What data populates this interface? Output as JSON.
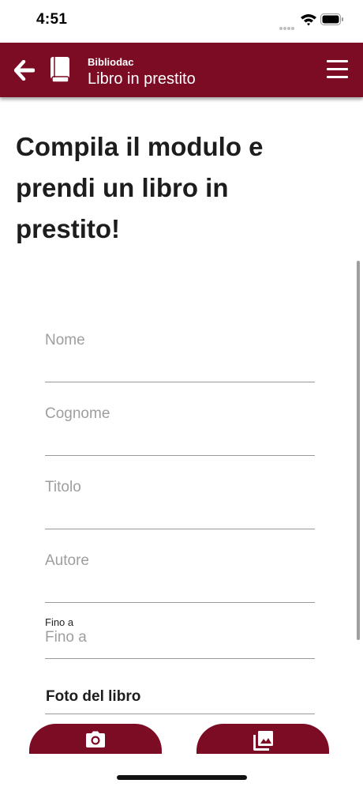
{
  "status_bar": {
    "time": "4:51"
  },
  "app_bar": {
    "subtitle": "Bibliodac",
    "title": "Libro in prestito"
  },
  "heading": "Compila il modulo e prendi un libro in prestito!",
  "form": {
    "nome": {
      "placeholder": "Nome",
      "value": ""
    },
    "cognome": {
      "placeholder": "Cognome",
      "value": ""
    },
    "titolo": {
      "placeholder": "Titolo",
      "value": ""
    },
    "autore": {
      "placeholder": "Autore",
      "value": ""
    },
    "fino_a": {
      "label": "Fino a",
      "placeholder": "Fino a",
      "value": ""
    }
  },
  "photo_section": {
    "label": "Foto del libro"
  },
  "buttons": [
    {
      "icon": "camera-icon"
    },
    {
      "icon": "gallery-icon"
    }
  ],
  "colors": {
    "accent": "#7b0c23",
    "text": "#1d1d1d",
    "placeholder": "#9e9e9e"
  }
}
